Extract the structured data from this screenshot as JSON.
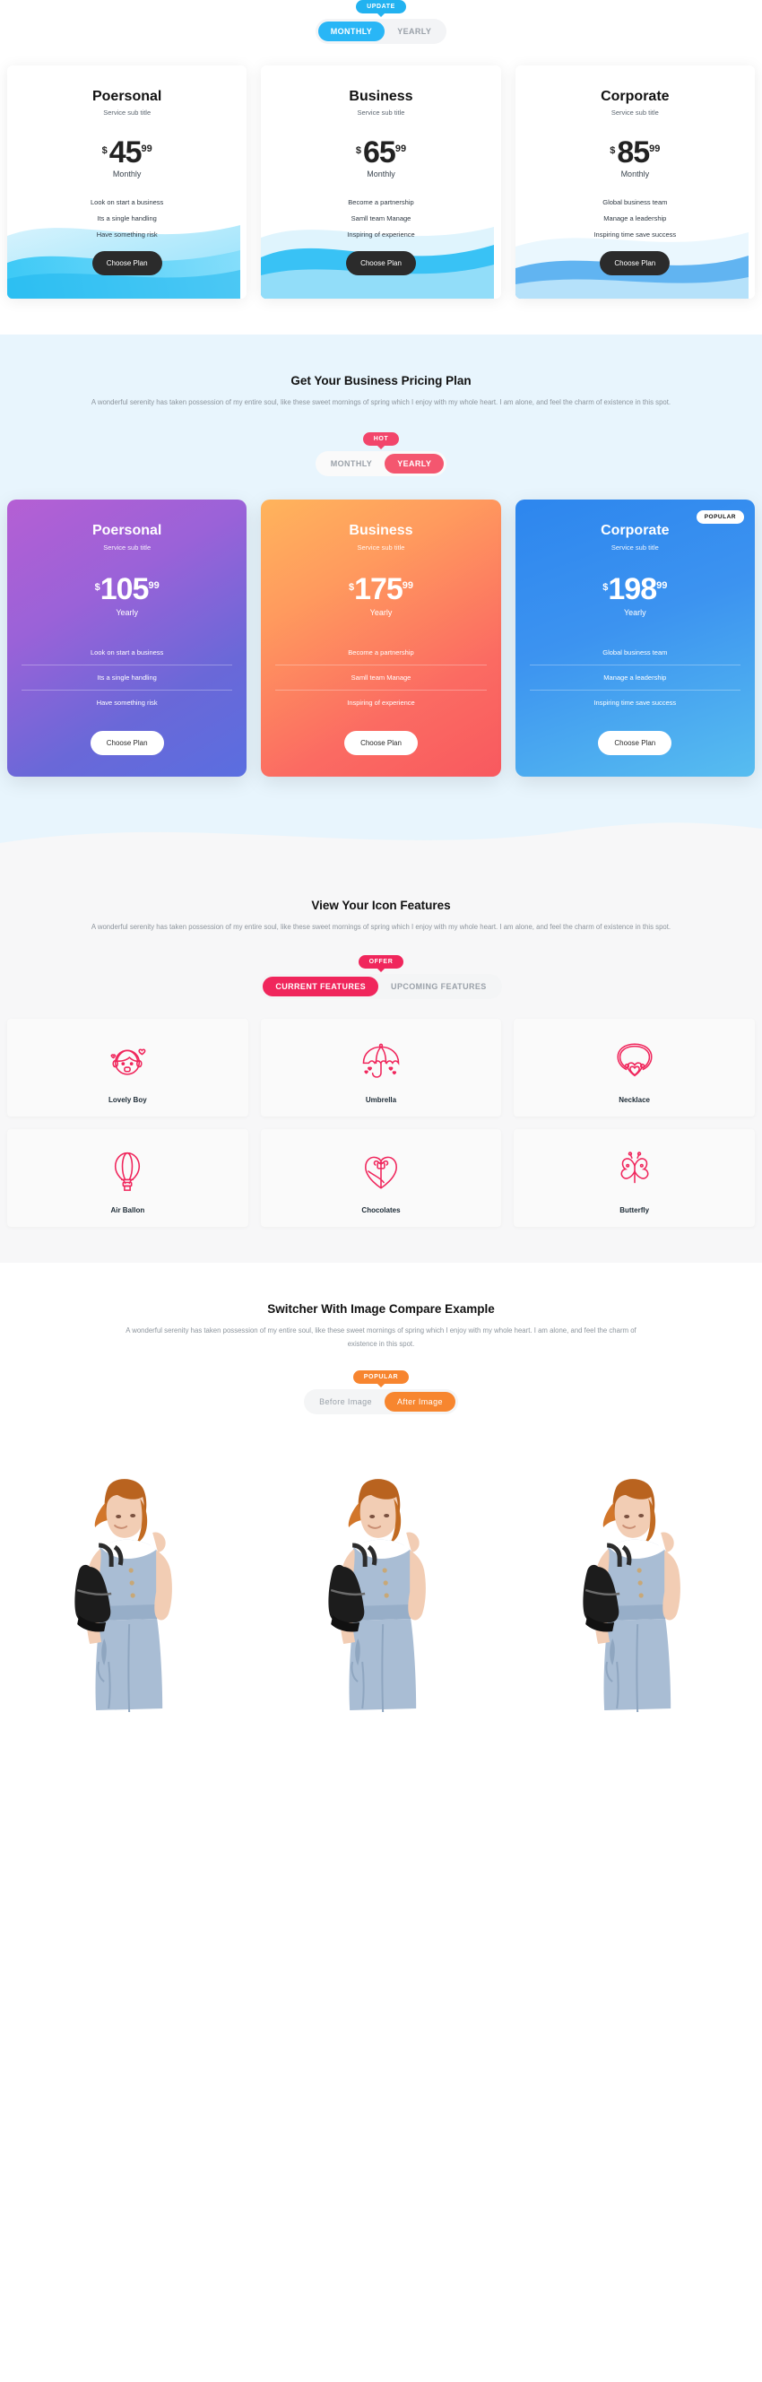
{
  "section1": {
    "badge": "UPDATE",
    "toggle": {
      "options": [
        "MONTHLY",
        "YEARLY"
      ],
      "active": "MONTHLY"
    },
    "cards": [
      {
        "title": "Poersonal",
        "subtitle": "Service sub title",
        "currency": "$",
        "amount": "45",
        "decimals": "99",
        "period": "Monthly",
        "features": [
          "Look on start a business",
          "Its a single handling",
          "Have something risk"
        ],
        "cta": "Choose Plan"
      },
      {
        "title": "Business",
        "subtitle": "Service sub title",
        "currency": "$",
        "amount": "65",
        "decimals": "99",
        "period": "Monthly",
        "features": [
          "Become a partnership",
          "Samll team Manage",
          "Inspiring of experience"
        ],
        "cta": "Choose Plan"
      },
      {
        "title": "Corporate",
        "subtitle": "Service sub title",
        "currency": "$",
        "amount": "85",
        "decimals": "99",
        "period": "Monthly",
        "features": [
          "Global business team",
          "Manage a leadership",
          "Inspiring time save success"
        ],
        "cta": "Choose Plan"
      }
    ]
  },
  "section2": {
    "heading": "Get Your Business Pricing Plan",
    "paragraph": "A wonderful serenity has taken possession of my entire soul, like these sweet mornings of spring which I enjoy with my whole heart. I am alone, and feel the charm of existence in this spot.",
    "badge": "HOT",
    "toggle": {
      "options": [
        "MONTHLY",
        "YEARLY"
      ],
      "active": "YEARLY"
    },
    "popular_badge": "POPULAR",
    "cards": [
      {
        "title": "Poersonal",
        "subtitle": "Service sub title",
        "currency": "$",
        "amount": "105",
        "decimals": "99",
        "period": "Yearly",
        "features": [
          "Look on start a business",
          "Its a single handling",
          "Have something risk"
        ],
        "cta": "Choose Plan"
      },
      {
        "title": "Business",
        "subtitle": "Service sub title",
        "currency": "$",
        "amount": "175",
        "decimals": "99",
        "period": "Yearly",
        "features": [
          "Become a partnership",
          "Samll team Manage",
          "Inspiring of experience"
        ],
        "cta": "Choose Plan"
      },
      {
        "title": "Corporate",
        "subtitle": "Service sub title",
        "currency": "$",
        "amount": "198",
        "decimals": "99",
        "period": "Yearly",
        "features": [
          "Global business team",
          "Manage a leadership",
          "Inspiring time save success"
        ],
        "cta": "Choose Plan"
      }
    ]
  },
  "section3": {
    "heading": "View Your Icon Features",
    "paragraph": "A wonderful serenity has taken possession of my entire soul, like these sweet mornings of spring which I enjoy with my whole heart. I am alone, and feel the charm of existence in this spot.",
    "badge": "OFFER",
    "tabs": {
      "options": [
        "CURRENT FEATURES",
        "UPCOMING FEATURES"
      ],
      "active": "CURRENT FEATURES"
    },
    "items": [
      {
        "label": "Lovely Boy",
        "icon": "lovely-boy-icon"
      },
      {
        "label": "Umbrella",
        "icon": "umbrella-icon"
      },
      {
        "label": "Necklace",
        "icon": "necklace-icon"
      },
      {
        "label": "Air Ballon",
        "icon": "air-balloon-icon"
      },
      {
        "label": "Chocolates",
        "icon": "chocolate-heart-icon"
      },
      {
        "label": "Butterfly",
        "icon": "butterfly-icon"
      }
    ]
  },
  "section4": {
    "heading": "Switcher With Image Compare Example",
    "paragraph": "A wonderful serenity has taken possession of my entire soul, like these sweet mornings of spring which I enjoy with my whole heart. I am alone, and feel the charm of existence in this spot.",
    "badge": "POPULAR",
    "toggle": {
      "options": [
        "Before Image",
        "After Image"
      ],
      "active": "After Image"
    },
    "images": [
      "woman-with-backpack",
      "woman-with-backpack",
      "woman-with-backpack"
    ]
  },
  "colors": {
    "blue": "#29b6f6",
    "pink": "#f4566f",
    "pink_strong": "#f0265c",
    "orange": "#f7862f",
    "dark": "#2b2b2b",
    "sec2_bg": "#e8f5fd",
    "sec3_bg": "#f7f7f8"
  }
}
